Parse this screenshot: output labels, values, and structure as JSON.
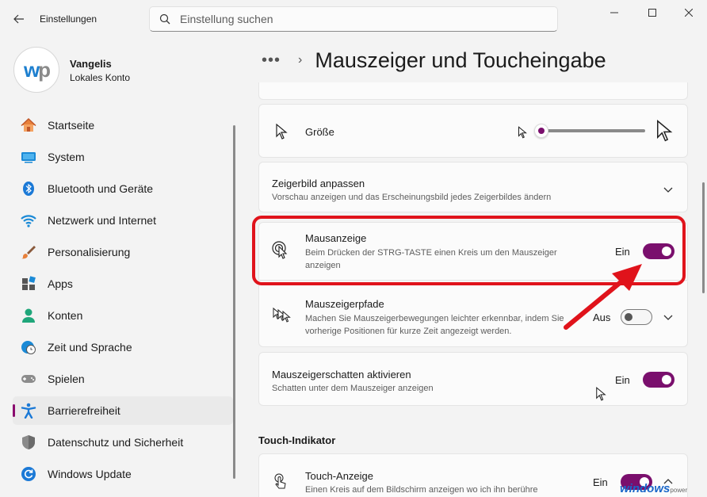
{
  "window": {
    "app_title": "Einstellungen",
    "search_placeholder": "Einstellung suchen"
  },
  "profile": {
    "name": "Vangelis",
    "account_type": "Lokales Konto",
    "logo_text": "wp"
  },
  "sidebar": {
    "items": [
      {
        "label": "Startseite",
        "icon": "home-icon"
      },
      {
        "label": "System",
        "icon": "system-icon"
      },
      {
        "label": "Bluetooth und Geräte",
        "icon": "bluetooth-icon"
      },
      {
        "label": "Netzwerk und Internet",
        "icon": "wifi-icon"
      },
      {
        "label": "Personalisierung",
        "icon": "brush-icon"
      },
      {
        "label": "Apps",
        "icon": "apps-icon"
      },
      {
        "label": "Konten",
        "icon": "account-icon"
      },
      {
        "label": "Zeit und Sprache",
        "icon": "clock-globe-icon"
      },
      {
        "label": "Spielen",
        "icon": "gamepad-icon"
      },
      {
        "label": "Barrierefreiheit",
        "icon": "accessibility-icon",
        "active": true
      },
      {
        "label": "Datenschutz und Sicherheit",
        "icon": "shield-icon"
      },
      {
        "label": "Windows Update",
        "icon": "update-icon"
      }
    ]
  },
  "breadcrumb": {
    "more": "•••",
    "title": "Mauszeiger und Toucheingabe"
  },
  "settings": {
    "size": {
      "title": "Größe",
      "slider_value": 0.0
    },
    "pointer_image": {
      "title": "Zeigerbild anpassen",
      "desc": "Vorschau anzeigen und das Erscheinungsbild jedes Zeigerbildes ändern"
    },
    "mouse_indicator": {
      "title": "Mausanzeige",
      "desc": "Beim Drücken der STRG-TASTE einen Kreis um den Mauszeiger anzeigen",
      "state_label": "Ein",
      "on": true
    },
    "pointer_trails": {
      "title": "Mauszeigerpfade",
      "desc": "Machen Sie Mauszeigerbewegungen leichter erkennbar, indem Sie vorherige Positionen für kurze Zeit angezeigt werden.",
      "state_label": "Aus",
      "on": false
    },
    "pointer_shadow": {
      "title": "Mauszeigerschatten aktivieren",
      "desc": "Schatten unter dem Mauszeiger anzeigen",
      "state_label": "Ein",
      "on": true
    }
  },
  "touch_section": {
    "heading": "Touch-Indikator",
    "touch_display": {
      "title": "Touch-Anzeige",
      "desc": "Einen Kreis auf dem Bildschirm anzeigen wo ich ihn berühre",
      "state_label": "Ein",
      "on": true
    }
  },
  "watermark": {
    "main": "windows",
    "sub": "power"
  },
  "colors": {
    "accent": "#7a0f6d",
    "highlight": "#e0131b"
  }
}
